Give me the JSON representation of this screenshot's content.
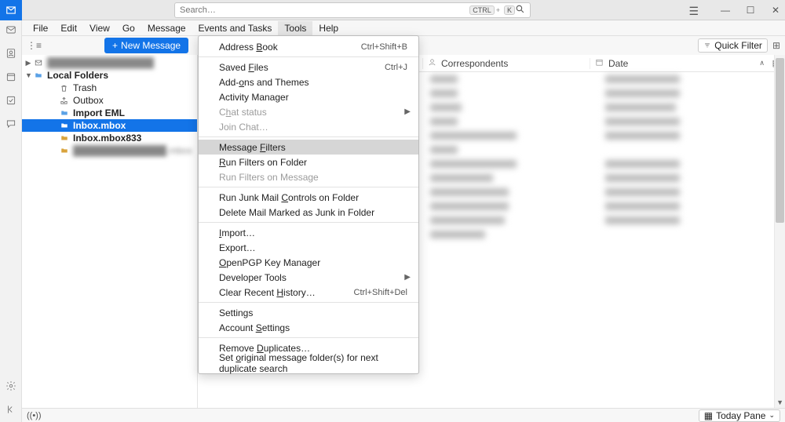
{
  "search": {
    "placeholder": "Search…",
    "kbd1": "CTRL",
    "kbd2": "K"
  },
  "menubar": [
    "File",
    "Edit",
    "View",
    "Go",
    "Message",
    "Events and Tasks",
    "Tools",
    "Help"
  ],
  "newMessage": "New Message",
  "quickFilter": "Quick Filter",
  "tree": {
    "account1": "████████████████",
    "localFolders": "Local Folders",
    "trash": "Trash",
    "outbox": "Outbox",
    "importEml": "Import EML",
    "inboxMbox": "Inbox.mbox",
    "inboxMbox833": "Inbox.mbox833",
    "blurred": "██████████████.mbox"
  },
  "columns": {
    "subject": "",
    "correspondents": "Correspondents",
    "date": "Date"
  },
  "tools": {
    "addressBook": {
      "label": "Address Book",
      "sc": "Ctrl+Shift+B",
      "u": 8
    },
    "savedFiles": {
      "label": "Saved Files",
      "sc": "Ctrl+J",
      "u": 6
    },
    "addons": {
      "label": "Add-ons and Themes",
      "u": 4
    },
    "activity": {
      "label": "Activity Manager",
      "u": null
    },
    "chatStatus": {
      "label": "Chat status",
      "u": 1
    },
    "joinChat": {
      "label": "Join Chat…",
      "u": null
    },
    "filters": {
      "label": "Message Filters",
      "u": 8
    },
    "runFolder": {
      "label": "Run Filters on Folder",
      "u": 0
    },
    "runMessage": {
      "label": "Run Filters on Message",
      "u": null
    },
    "junkFolder": {
      "label": "Run Junk Mail Controls on Folder",
      "u": 14
    },
    "deleteJunk": {
      "label": "Delete Mail Marked as Junk in Folder",
      "u": null
    },
    "import": {
      "label": "Import…",
      "u": 0
    },
    "export": {
      "label": "Export…",
      "u": null
    },
    "openpgp": {
      "label": "OpenPGP Key Manager",
      "u": 0
    },
    "devtools": {
      "label": "Developer Tools",
      "u": null
    },
    "clearHistory": {
      "label": "Clear Recent History…",
      "sc": "Ctrl+Shift+Del",
      "u": 13
    },
    "settings": {
      "label": "Settings",
      "u": null
    },
    "accountSettings": {
      "label": "Account Settings",
      "u": 8
    },
    "removeDup": {
      "label": "Remove Duplicates…",
      "u": 7
    },
    "setOriginal": {
      "label": "Set original message folder(s) for next duplicate search",
      "u": 4
    }
  },
  "todayPane": "Today Pane"
}
